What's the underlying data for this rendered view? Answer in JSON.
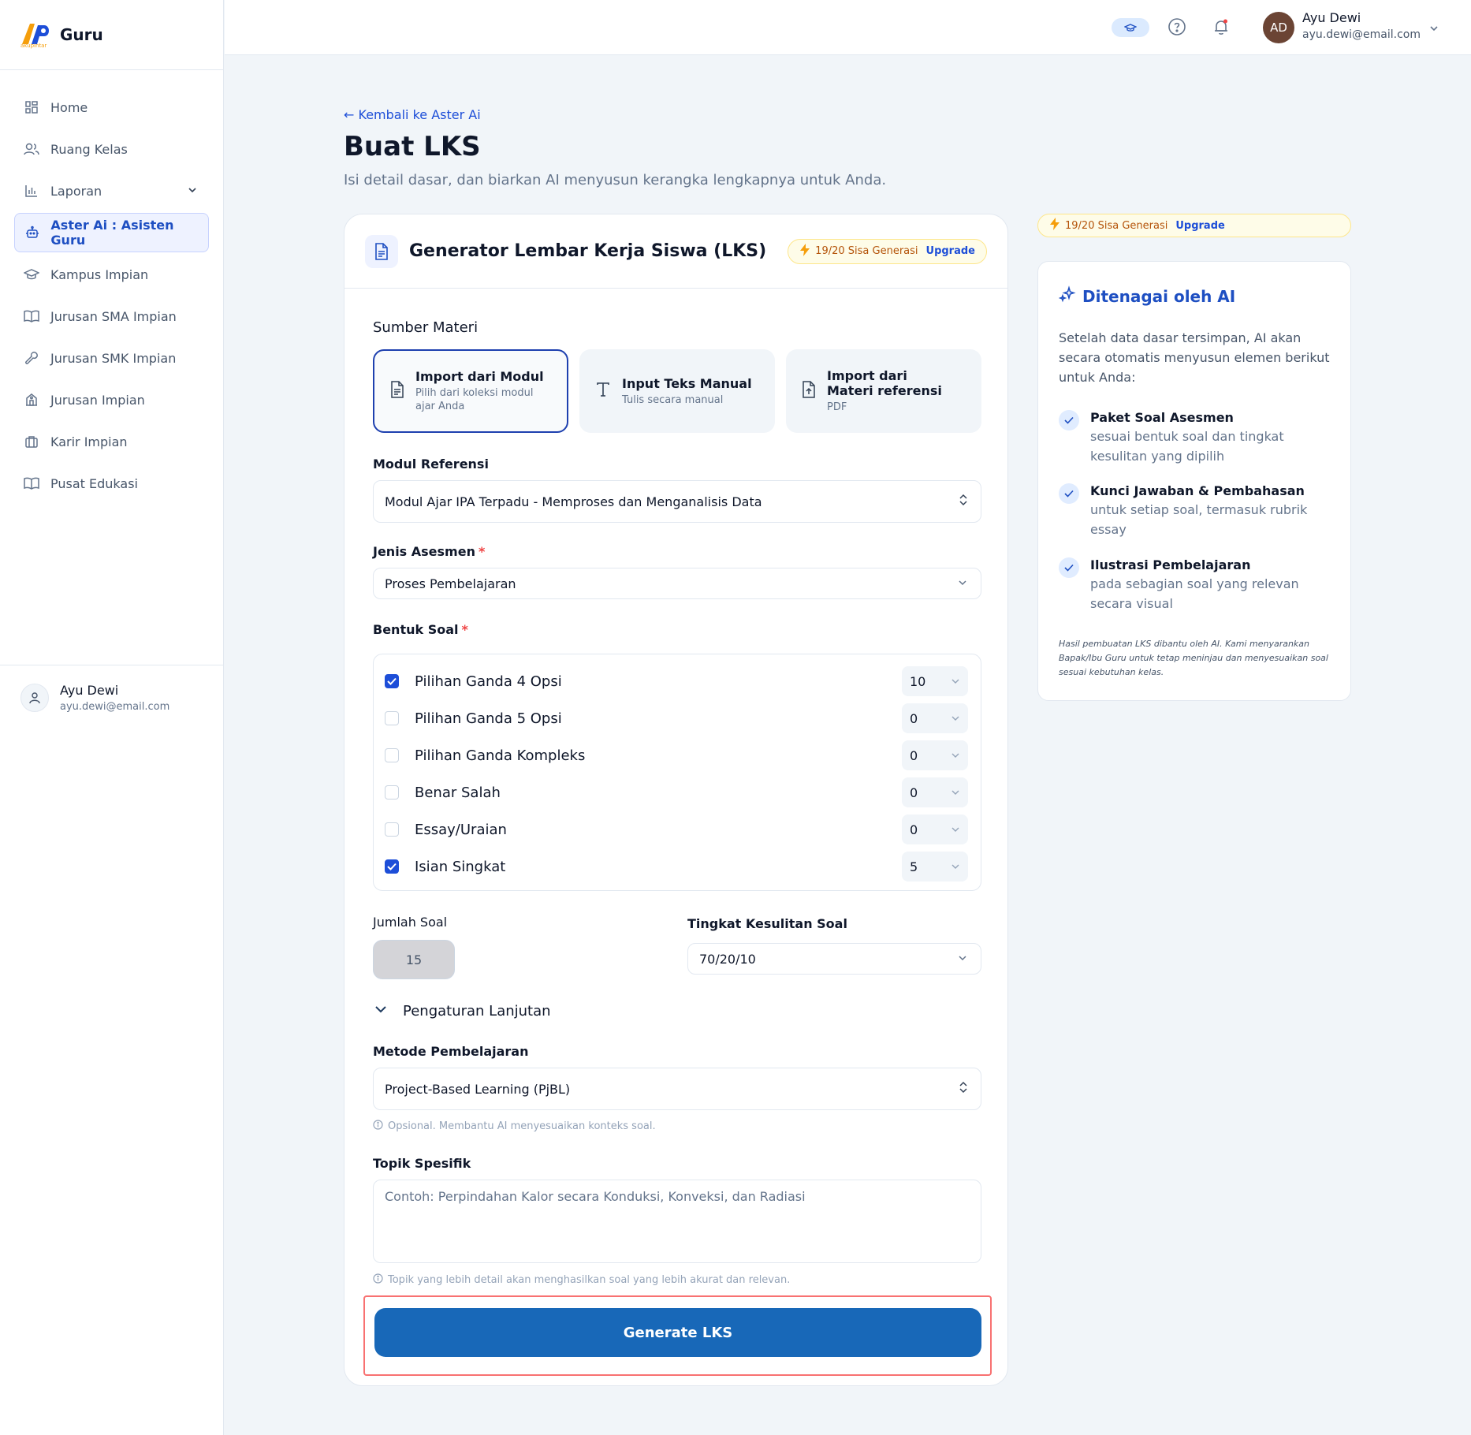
{
  "brand": {
    "name": "Guru",
    "logo_caption": "akupintar"
  },
  "sidebar": {
    "items": [
      {
        "label": "Home",
        "icon": "grid-icon"
      },
      {
        "label": "Ruang Kelas",
        "icon": "users-icon"
      },
      {
        "label": "Laporan",
        "icon": "bar-chart-icon"
      },
      {
        "label": "Aster Ai : Asisten Guru",
        "icon": "robot-icon",
        "active": true
      },
      {
        "label": "Kampus Impian",
        "icon": "graduation-cap-icon"
      },
      {
        "label": "Jurusan SMA Impian",
        "icon": "book-open-icon"
      },
      {
        "label": "Jurusan SMK Impian",
        "icon": "wrench-icon"
      },
      {
        "label": "Jurusan Impian",
        "icon": "building-icon"
      },
      {
        "label": "Karir Impian",
        "icon": "briefcase-icon"
      },
      {
        "label": "Pusat Edukasi",
        "icon": "book-icon"
      }
    ],
    "user": {
      "name": "Ayu Dewi",
      "email": "ayu.dewi@email.com"
    }
  },
  "topbar": {
    "user": {
      "initials": "AD",
      "name": "Ayu Dewi",
      "email": "ayu.dewi@email.com"
    }
  },
  "page": {
    "back_link": "Kembali ke Aster Ai",
    "title": "Buat LKS",
    "subtitle": "Isi detail dasar, dan biarkan AI menyusun kerangka lengkapnya untuk Anda."
  },
  "quota": {
    "text": "19/20 Sisa Generasi",
    "upgrade": "Upgrade"
  },
  "form": {
    "card_title": "Generator Lembar Kerja Siswa (LKS)",
    "source_label": "Sumber Materi",
    "sources": [
      {
        "title": "Import dari Modul",
        "desc": "Pilih dari koleksi modul ajar Anda",
        "selected": true
      },
      {
        "title": "Input Teks Manual",
        "desc": "Tulis secara manual",
        "selected": false
      },
      {
        "title": "Import dari Materi referensi",
        "desc": "PDF",
        "selected": false
      }
    ],
    "modul_label": "Modul Referensi",
    "modul_value": "Modul Ajar IPA Terpadu - Memproses dan Menganalisis Data",
    "jenis_label": "Jenis Asesmen",
    "jenis_value": "Proses Pembelajaran",
    "bentuk_label": "Bentuk Soal",
    "required_mark": "*",
    "question_types": [
      {
        "label": "Pilihan Ganda 4 Opsi",
        "checked": true,
        "count": "10"
      },
      {
        "label": "Pilihan Ganda 5 Opsi",
        "checked": false,
        "count": "0"
      },
      {
        "label": "Pilihan Ganda Kompleks",
        "checked": false,
        "count": "0"
      },
      {
        "label": "Benar Salah",
        "checked": false,
        "count": "0"
      },
      {
        "label": "Essay/Uraian",
        "checked": false,
        "count": "0"
      },
      {
        "label": "Isian Singkat",
        "checked": true,
        "count": "5"
      }
    ],
    "jumlah_label": "Jumlah Soal",
    "jumlah_value": "15",
    "tingkat_label": "Tingkat Kesulitan Soal",
    "tingkat_value": "70/20/10",
    "advanced_label": "Pengaturan Lanjutan",
    "metode_label": "Metode Pembelajaran",
    "metode_value": "Project-Based Learning (PjBL)",
    "metode_hint": "Opsional. Membantu AI menyesuaikan konteks soal.",
    "topik_label": "Topik Spesifik",
    "topik_placeholder": "Contoh: Perpindahan Kalor secara Konduksi, Konveksi, dan Radiasi",
    "topik_hint": "Topik yang lebih detail akan menghasilkan soal yang lebih akurat dan relevan.",
    "generate_label": "Generate LKS"
  },
  "ai_panel": {
    "title": "Ditenagai oleh AI",
    "intro": "Setelah data dasar tersimpan, AI akan secara otomatis menyusun elemen berikut untuk Anda:",
    "items": [
      {
        "title": "Paket Soal Asesmen",
        "desc": "sesuai bentuk soal dan tingkat kesulitan yang dipilih"
      },
      {
        "title": "Kunci Jawaban & Pembahasan",
        "desc": "untuk setiap soal, termasuk rubrik essay"
      },
      {
        "title": "Ilustrasi Pembelajaran",
        "desc": "pada sebagian soal yang relevan secara visual"
      }
    ],
    "note": "Hasil pembuatan LKS dibantu oleh AI. Kami menyarankan Bapak/Ibu Guru untuk tetap meninjau dan menyesuaikan soal sesuai kebutuhan kelas."
  },
  "colors": {
    "primary": "#1868b8",
    "accent": "#1e4fc2",
    "warning": "#b45309",
    "danger": "#ef4444"
  }
}
